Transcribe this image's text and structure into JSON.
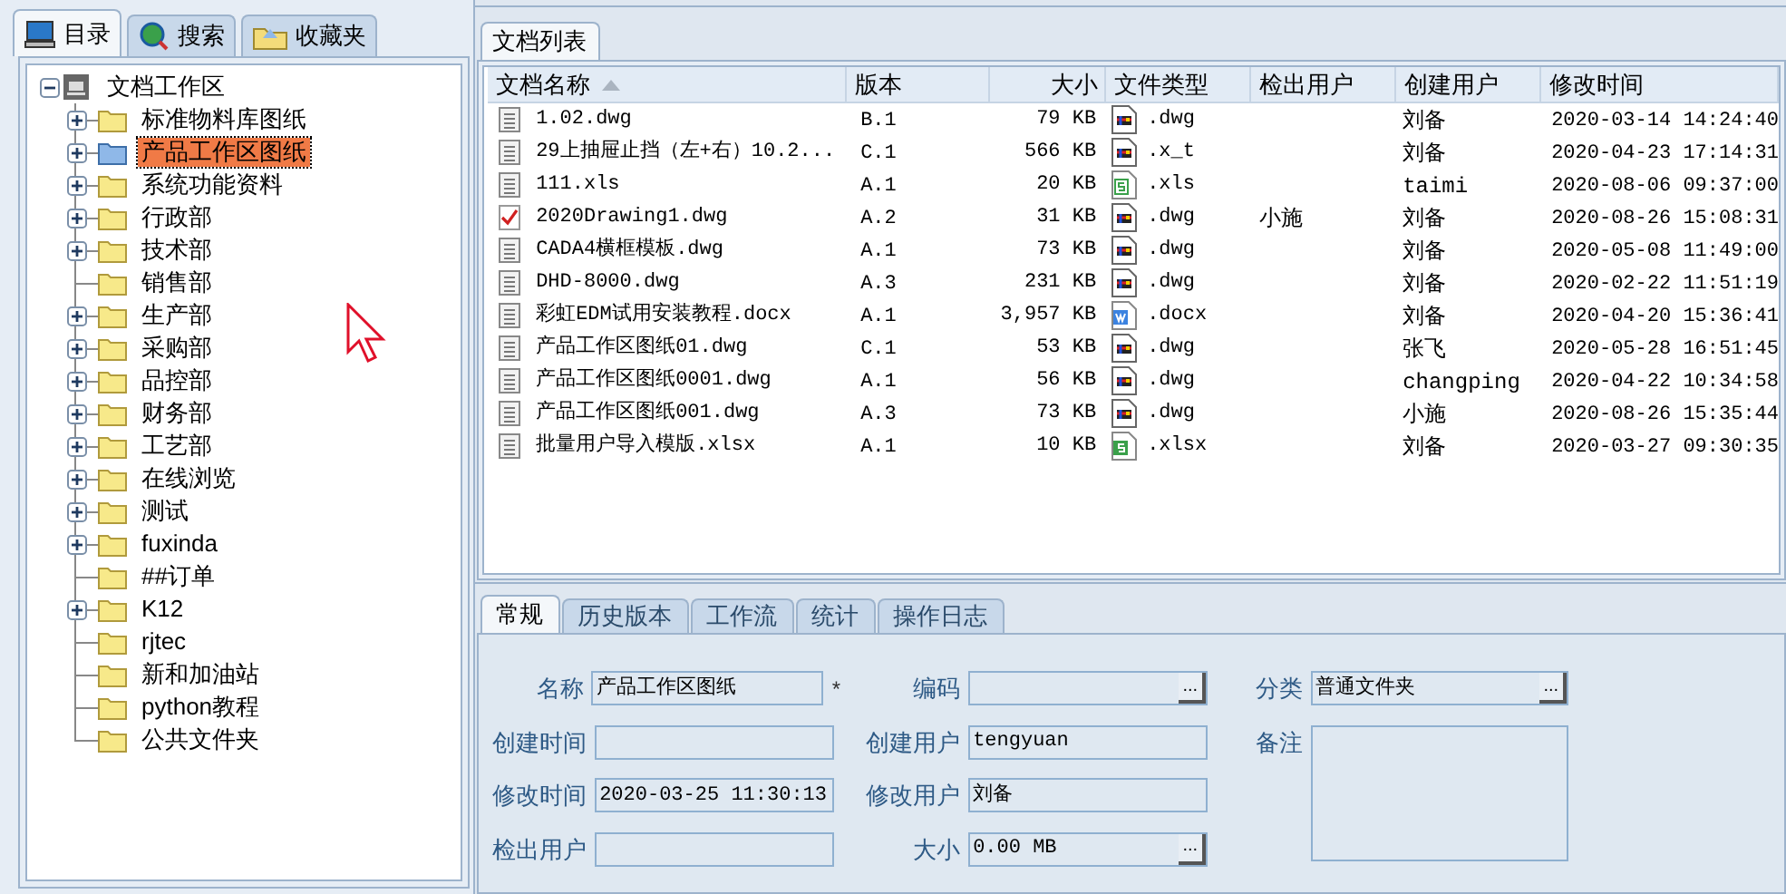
{
  "left_tabs": [
    {
      "label": "目录",
      "selected": true
    },
    {
      "label": "搜索",
      "selected": false
    },
    {
      "label": "收藏夹",
      "selected": false
    }
  ],
  "tree": {
    "label": "文档工作区",
    "expanded": true,
    "children": [
      {
        "label": "标准物料库图纸",
        "expandable": true,
        "selected": false
      },
      {
        "label": "产品工作区图纸",
        "expandable": true,
        "selected": true
      },
      {
        "label": "系统功能资料",
        "expandable": true,
        "selected": false
      },
      {
        "label": "行政部",
        "expandable": true,
        "selected": false
      },
      {
        "label": "技术部",
        "expandable": true,
        "selected": false
      },
      {
        "label": "销售部",
        "expandable": false,
        "selected": false
      },
      {
        "label": "生产部",
        "expandable": true,
        "selected": false
      },
      {
        "label": "采购部",
        "expandable": true,
        "selected": false
      },
      {
        "label": "品控部",
        "expandable": true,
        "selected": false
      },
      {
        "label": "财务部",
        "expandable": true,
        "selected": false
      },
      {
        "label": "工艺部",
        "expandable": true,
        "selected": false
      },
      {
        "label": "在线浏览",
        "expandable": true,
        "selected": false
      },
      {
        "label": "测试",
        "expandable": true,
        "selected": false
      },
      {
        "label": "fuxinda",
        "expandable": true,
        "selected": false
      },
      {
        "label": "##订单",
        "expandable": false,
        "selected": false
      },
      {
        "label": "K12",
        "expandable": true,
        "selected": false
      },
      {
        "label": "rjtec",
        "expandable": false,
        "selected": false
      },
      {
        "label": "新和加油站",
        "expandable": false,
        "selected": false
      },
      {
        "label": "python教程",
        "expandable": false,
        "selected": false
      },
      {
        "label": "公共文件夹",
        "expandable": false,
        "selected": false
      }
    ]
  },
  "list_tab": {
    "label": "文档列表",
    "selected": true
  },
  "table": {
    "columns": [
      {
        "label": "文档名称",
        "sorted": true
      },
      {
        "label": "版本",
        "sorted": false
      },
      {
        "label": "大小",
        "sorted": false
      },
      {
        "label": "文件类型",
        "sorted": false
      },
      {
        "label": "检出用户",
        "sorted": false
      },
      {
        "label": "创建用户",
        "sorted": false
      },
      {
        "label": "修改时间",
        "sorted": false
      }
    ],
    "rows": [
      {
        "name": "1.02.dwg",
        "checked_out": false,
        "version": "B.1",
        "size": "79 KB",
        "kind": "cad",
        "type": ".dwg",
        "creator": "刘备",
        "modified": "2020-03-14 14:24:40"
      },
      {
        "name": "29上抽屉止挡（左+右）10.2...",
        "checked_out": false,
        "version": "C.1",
        "size": "566 KB",
        "kind": "cad",
        "type": ".x_t",
        "creator": "刘备",
        "modified": "2020-04-23 17:14:31"
      },
      {
        "name": "111.xls",
        "checked_out": false,
        "version": "A.1",
        "size": "20 KB",
        "kind": "sheet-outline",
        "type": ".xls",
        "creator": "taimi",
        "modified": "2020-08-06 09:37:00"
      },
      {
        "name": "2020Drawing1.dwg",
        "checked_out": true,
        "version": "A.2",
        "size": "31 KB",
        "kind": "cad",
        "type": ".dwg",
        "checkout_user": "小施",
        "creator": "刘备",
        "modified": "2020-08-26 15:08:31"
      },
      {
        "name": "CADA4横框模板.dwg",
        "checked_out": false,
        "version": "A.1",
        "size": "73 KB",
        "kind": "cad",
        "type": ".dwg",
        "creator": "刘备",
        "modified": "2020-05-08 11:49:00"
      },
      {
        "name": "DHD-8000.dwg",
        "checked_out": false,
        "version": "A.3",
        "size": "231 KB",
        "kind": "cad",
        "type": ".dwg",
        "creator": "刘备",
        "modified": "2020-02-22 11:51:19"
      },
      {
        "name": "彩虹EDM试用安装教程.docx",
        "checked_out": false,
        "version": "A.1",
        "size": "3,957 KB",
        "kind": "word",
        "type": ".docx",
        "creator": "刘备",
        "modified": "2020-04-20 15:36:41"
      },
      {
        "name": "产品工作区图纸01.dwg",
        "checked_out": false,
        "version": "C.1",
        "size": "53 KB",
        "kind": "cad",
        "type": ".dwg",
        "creator": "张飞",
        "modified": "2020-05-28 16:51:45"
      },
      {
        "name": "产品工作区图纸0001.dwg",
        "checked_out": false,
        "version": "A.1",
        "size": "56 KB",
        "kind": "cad",
        "type": ".dwg",
        "creator": "changping",
        "modified": "2020-04-22 10:34:58"
      },
      {
        "name": "产品工作区图纸001.dwg",
        "checked_out": false,
        "version": "A.3",
        "size": "73 KB",
        "kind": "cad",
        "type": ".dwg",
        "creator": "小施",
        "modified": "2020-08-26 15:35:44"
      },
      {
        "name": "批量用户导入模版.xlsx",
        "checked_out": false,
        "version": "A.1",
        "size": "10 KB",
        "kind": "sheet",
        "type": ".xlsx",
        "creator": "刘备",
        "modified": "2020-03-27 09:30:35"
      }
    ]
  },
  "detail_tabs": [
    {
      "label": "常规",
      "selected": true
    },
    {
      "label": "历史版本",
      "selected": false
    },
    {
      "label": "工作流",
      "selected": false
    },
    {
      "label": "统计",
      "selected": false
    },
    {
      "label": "操作日志",
      "selected": false
    }
  ],
  "form": {
    "columns": [
      [
        {
          "label": "名称",
          "value": "产品工作区图纸",
          "required": true,
          "required_mark": "*"
        },
        {
          "label": "创建时间"
        },
        {
          "label": "修改时间",
          "value": "2020-03-25 11:30:13"
        },
        {
          "label": "检出用户"
        }
      ],
      [
        {
          "label": "编码",
          "button_label": "..."
        },
        {
          "label": "创建用户",
          "value": "tengyuan"
        },
        {
          "label": "修改用户",
          "value": "刘备"
        },
        {
          "label": "大小",
          "value": "0.00 MB",
          "button_label": "..."
        }
      ],
      [
        {
          "label": "分类",
          "value": "普通文件夹",
          "button_label": "..."
        },
        {
          "label": "备注",
          "kind": "textarea"
        }
      ]
    ]
  }
}
